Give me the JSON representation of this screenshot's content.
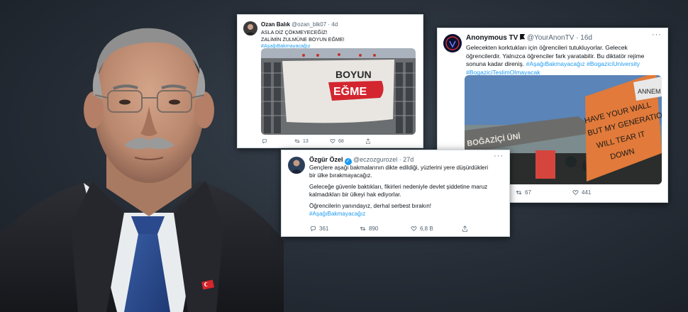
{
  "tweet_ozan": {
    "name": "Ozan Balık",
    "meta": "@ozan_blk07 · 4d",
    "lines": [
      "ASLA DİZ ÇÖKMEYECEĞİZ!",
      "ZALİMİN ZULMÜNE BOYUN EĞME!"
    ],
    "hashtag": "#AşağıBakmayacağız",
    "banner_text_1": "BOYUN",
    "banner_text_2": "EĞME",
    "retweets": "13",
    "likes": "68"
  },
  "tweet_anon": {
    "name": "Anonymous TV",
    "meta": "@YourAnonTV · 16d",
    "lines": [
      "Gelecekten korktukları için öğrencileri tutukluyorlar. Gelecek",
      "öğrencilerdir. Yalnızca öğrenciler fark yaratabilir. Bu diktatör rejime"
    ],
    "line3": "sonuna kadar direniş.",
    "line3_tags": "#AşağıBakmayacağız #BogaziciUniversity",
    "hashtag2": "#BogaziciTeslimOlmayacak",
    "gate_text": "BOĞAZİÇİ ÜNİ",
    "sign_text": [
      "HAVE YOUR WALL",
      "BUT MY GENERATION",
      "WILL TEAR IT",
      "DOWN"
    ],
    "sign2_text": "ANNEM",
    "retweets": "67",
    "likes": "441"
  },
  "tweet_ozel": {
    "name": "Özgür Özel",
    "meta": "@eczozgurozel · 27d",
    "para1": [
      "Gençlere aşağı bakmalarının dikte edildiği, yüzlerini yere düşürdükleri",
      "bir ülke bırakmayacağız."
    ],
    "para2": [
      "Geleceğe güvenle baktıkları, fikirleri nedeniyle devlet şiddetine maruz",
      "kalmadıkları bir ülkeyi hak ediyorlar."
    ],
    "para3": "Öğrencilerin yanındayız, derhal serbest bırakın!",
    "hashtag": "#AşağıBakmayacağız",
    "replies": "361",
    "retweets": "890",
    "likes": "6,8 B"
  },
  "colors": {
    "link": "#1d9bf0",
    "muted": "#536471",
    "background": "#262d36"
  },
  "icons": [
    "reply-icon",
    "retweet-icon",
    "like-icon",
    "share-icon",
    "more-icon",
    "verified-badge-icon",
    "flag-icon",
    "turkish-flag-pin-icon"
  ]
}
